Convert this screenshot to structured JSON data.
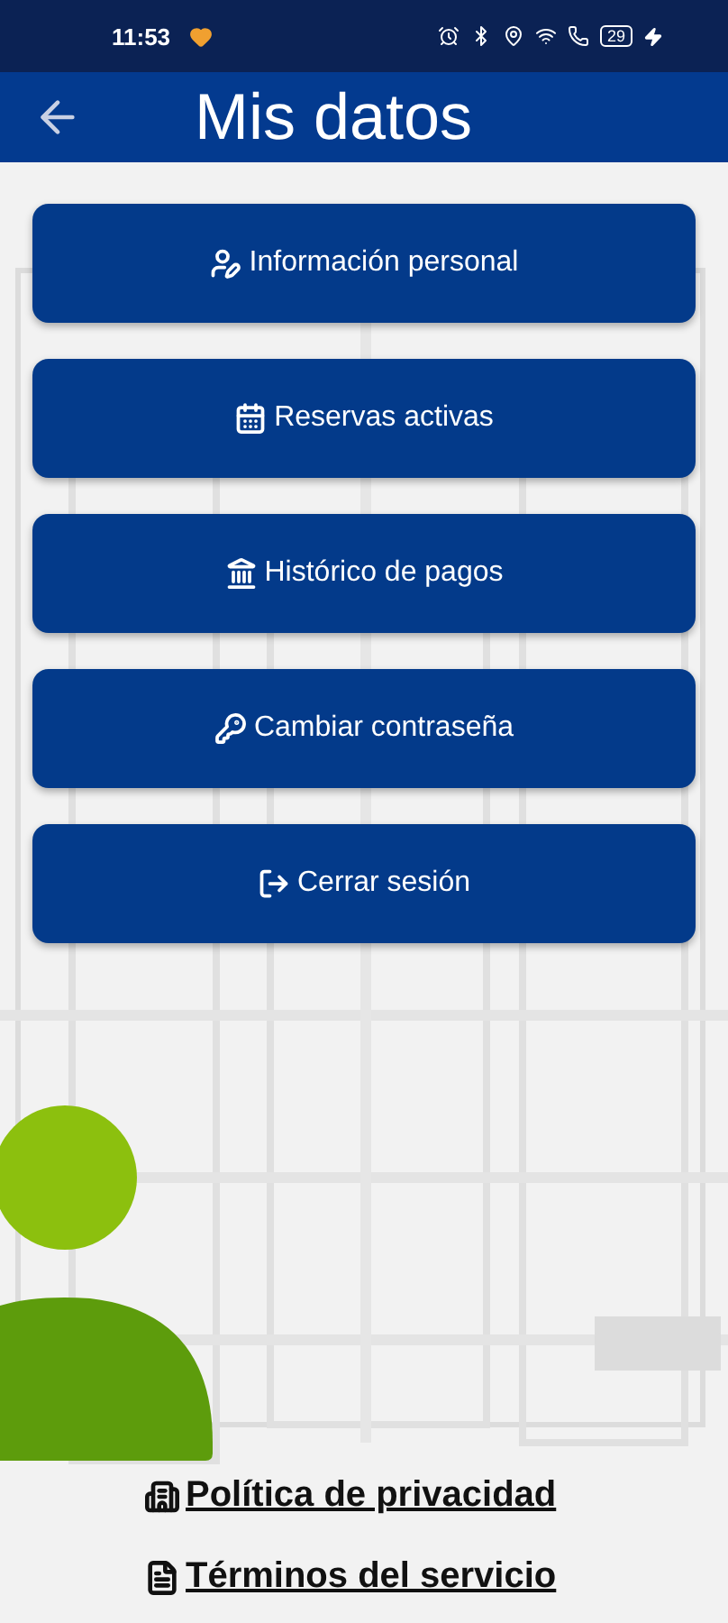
{
  "status_bar": {
    "time": "11:53",
    "battery": "29"
  },
  "header": {
    "title": "Mis datos"
  },
  "menu": [
    {
      "label": "Información personal",
      "kind": "user"
    },
    {
      "label": "Reservas activas",
      "kind": "calendar"
    },
    {
      "label": "Histórico de pagos",
      "kind": "bank"
    },
    {
      "label": "Cambiar contraseña",
      "kind": "key"
    },
    {
      "label": "Cerrar sesión",
      "kind": "logout"
    }
  ],
  "links": [
    {
      "label": "Política de privacidad",
      "kind": "privacy"
    },
    {
      "label": "Términos del servicio",
      "kind": "terms"
    }
  ]
}
